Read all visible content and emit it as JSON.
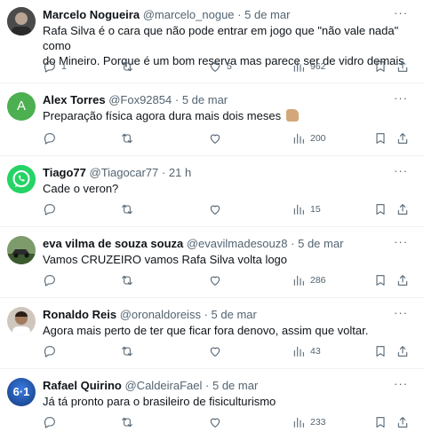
{
  "tweets": [
    {
      "name": "Marcelo Nogueira",
      "handle": "@marcelo_nogue",
      "time": "5 de mar",
      "text_line1": "Rafa Silva é o cara que não pode entrar em jogo que \"não vale nada\" como",
      "text_line2": "do Mineiro. Porque é um bom reserva mas parece ser de vidro demais",
      "replies": "1",
      "retweets": "",
      "likes": "5",
      "views": "962",
      "avatar": "person-photo",
      "avatar_color": "#5a5a5a"
    },
    {
      "name": "Alex Torres",
      "handle": "@Fox92854",
      "time": "5 de mar",
      "text_line1": "Preparação física agora dura mais dois meses",
      "text_line2": "",
      "emoji": "thumbs-up-emoji",
      "replies": "",
      "retweets": "",
      "likes": "",
      "views": "200",
      "avatar": "letter-avatar",
      "avatar_letter": "A",
      "avatar_color": "#4caf50"
    },
    {
      "name": "Tiago77",
      "handle": "@Tiagocar77",
      "time": "21 h",
      "text_line1": "Cade o veron?",
      "text_line2": "",
      "replies": "",
      "retweets": "",
      "likes": "",
      "views": "15",
      "avatar": "whatsapp-logo",
      "avatar_color": "#25d366"
    },
    {
      "name": "eva vilma de souza souza",
      "handle": "@evavilmadesouz8",
      "time": "5 de mar",
      "text_line1": "Vamos CRUZEIRO vamos Rafa Silva volta logo",
      "text_line2": "",
      "replies": "",
      "retweets": "",
      "likes": "",
      "views": "286",
      "avatar": "car-photo",
      "avatar_color": "#3b6b2f"
    },
    {
      "name": "Ronaldo Reis",
      "handle": "@oronaldoreiss",
      "time": "5 de mar",
      "text_line1": "Agora mais perto de ter que ficar fora denovo, assim que voltar.",
      "text_line2": "",
      "replies": "",
      "retweets": "",
      "likes": "",
      "views": "43",
      "avatar": "person-photo",
      "avatar_color": "#8a7f74"
    },
    {
      "name": "Rafael Quirino",
      "handle": "@CaldeiraFael",
      "time": "5 de mar",
      "text_line1": "Já tá pronto para o brasileiro de fisiculturismo",
      "text_line2": "",
      "replies": "",
      "retweets": "",
      "likes": "",
      "views": "233",
      "avatar": "6x1-logo",
      "avatar_text": "6·1",
      "avatar_color": "#1d4fa3"
    }
  ],
  "more_label": "···",
  "dot": "·",
  "colors": {
    "text": "#0f1419",
    "muted": "#536471",
    "divider": "#eff3f4"
  }
}
